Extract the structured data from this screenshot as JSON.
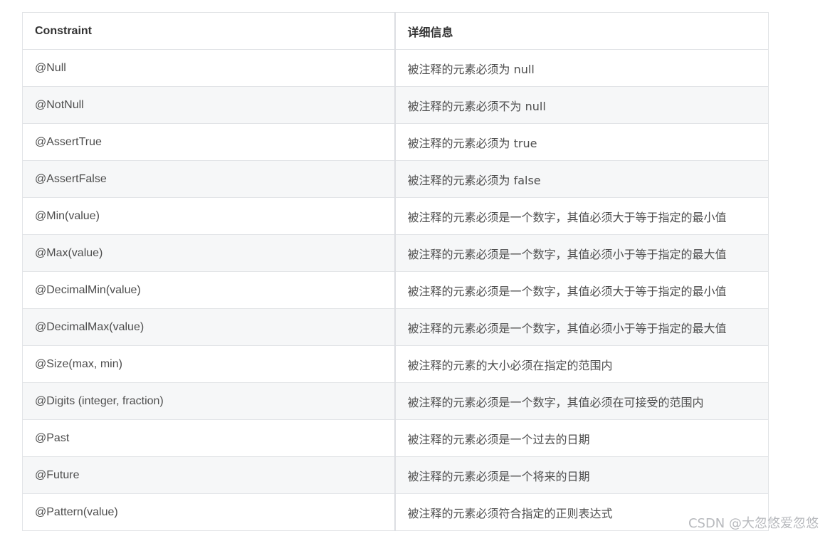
{
  "table": {
    "headers": [
      "Constraint",
      "详细信息"
    ],
    "rows": [
      [
        "@Null",
        "被注释的元素必须为 null"
      ],
      [
        "@NotNull",
        "被注释的元素必须不为 null"
      ],
      [
        "@AssertTrue",
        "被注释的元素必须为 true"
      ],
      [
        "@AssertFalse",
        "被注释的元素必须为 false"
      ],
      [
        "@Min(value)",
        "被注释的元素必须是一个数字，其值必须大于等于指定的最小值"
      ],
      [
        "@Max(value)",
        "被注释的元素必须是一个数字，其值必须小于等于指定的最大值"
      ],
      [
        "@DecimalMin(value)",
        "被注释的元素必须是一个数字，其值必须大于等于指定的最小值"
      ],
      [
        "@DecimalMax(value)",
        "被注释的元素必须是一个数字，其值必须小于等于指定的最大值"
      ],
      [
        "@Size(max, min)",
        "被注释的元素的大小必须在指定的范围内"
      ],
      [
        "@Digits (integer, fraction)",
        "被注释的元素必须是一个数字，其值必须在可接受的范围内"
      ],
      [
        "@Past",
        "被注释的元素必须是一个过去的日期"
      ],
      [
        "@Future",
        "被注释的元素必须是一个将来的日期"
      ],
      [
        "@Pattern(value)",
        "被注释的元素必须符合指定的正则表达式"
      ]
    ]
  },
  "watermark": "CSDN @大忽悠爱忽悠"
}
